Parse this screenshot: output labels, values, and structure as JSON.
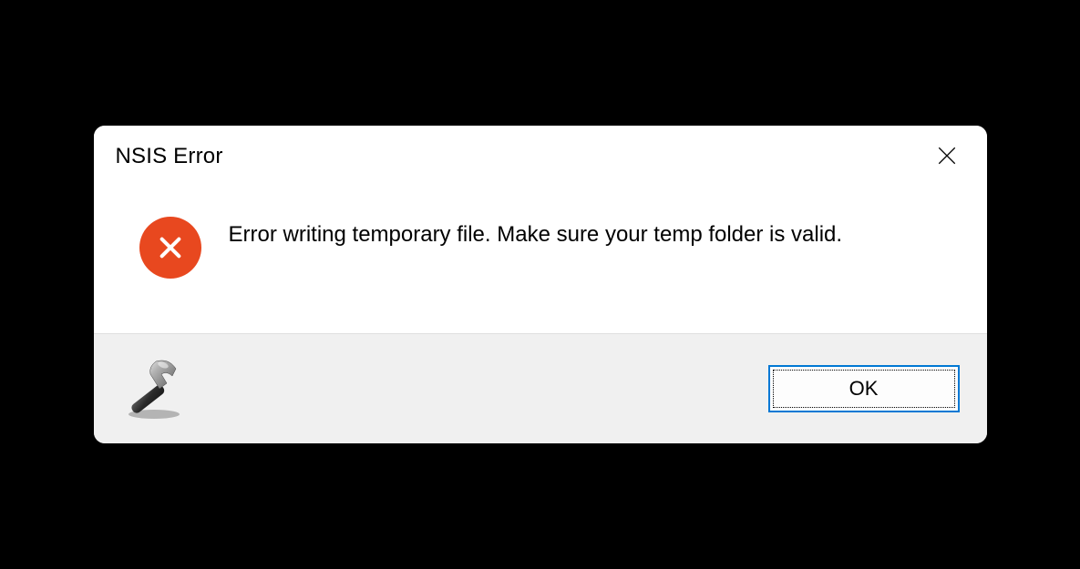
{
  "dialog": {
    "title": "NSIS Error",
    "message": "Error writing temporary file. Make sure your temp folder is valid.",
    "ok_label": "OK"
  },
  "icons": {
    "error": "error-cross-icon",
    "close": "close-icon",
    "hammer": "hammer-icon"
  },
  "colors": {
    "error_circle": "#e8481f",
    "button_focus": "#0078d4",
    "footer_bg": "#f0f0f0"
  }
}
